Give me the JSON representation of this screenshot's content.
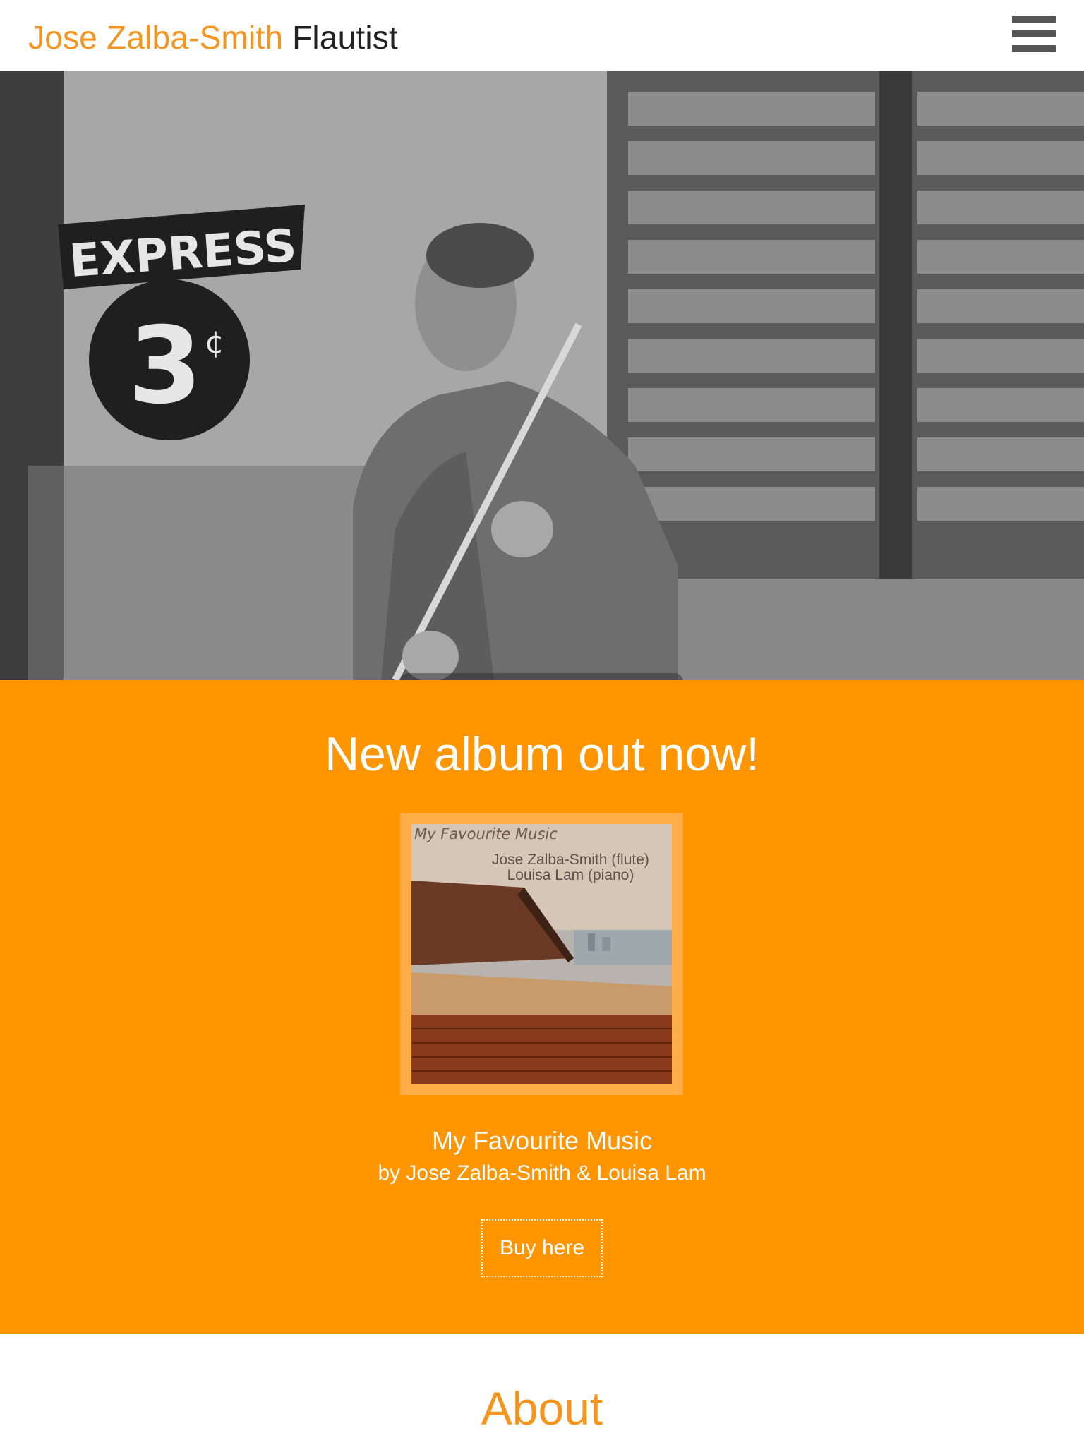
{
  "header": {
    "name": "Jose Zalba-Smith",
    "role": "Flautist",
    "menu_icon": "hamburger-menu-icon"
  },
  "hero": {
    "wall_sign": "EXPRESS",
    "wall_sign_number": "3",
    "wall_sign_cents": "¢",
    "slide_count": 6,
    "active_slide": 3
  },
  "album": {
    "heading": "New album out now!",
    "cover_title": "My Favourite Music",
    "cover_credit_1": "Jose Zalba-Smith (flute)",
    "cover_credit_2": "Louisa Lam (piano)",
    "title": "My Favourite Music",
    "byline": "by Jose Zalba-Smith & Louisa Lam",
    "buy_label": "Buy here"
  },
  "about": {
    "heading": "About"
  },
  "colors": {
    "accent": "#f7941d",
    "section_bg": "#ff9500",
    "header_text": "#222222"
  }
}
